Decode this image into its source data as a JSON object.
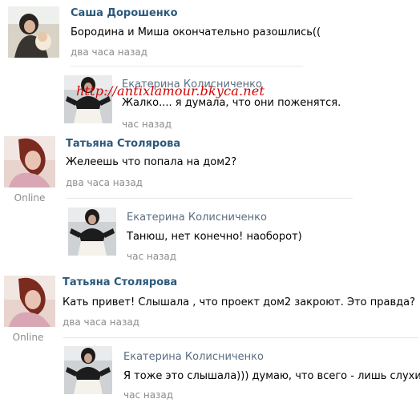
{
  "watermark": "http://antixlamour.bkyca.net",
  "comments": [
    {
      "author": "Саша Дорошенко",
      "text": "Бородина и Миша окончательно разошлись((",
      "time": "два часа назад"
    },
    {
      "author": "Екатерина Колисниченко",
      "text": "Жалко.... я думала, что они поженятся.",
      "time": "час назад"
    },
    {
      "author": "Татьяна Столярова",
      "text": "Желеешь что попала на дом2?",
      "time": "два часа назад",
      "status": "Online"
    },
    {
      "author": "Екатерина Колисниченко",
      "text": "Танюш, нет конечно! наоборот)",
      "time": "час назад"
    },
    {
      "author": "Татьяна Столярова",
      "text": "Кать привет! Слышала , что проект дом2 закроют. Это правда?",
      "time": "два часа назад",
      "status": "Online"
    },
    {
      "author": "Екатерина Колисниченко",
      "text": "Я тоже это слышала))) думаю, что всего - лишь слухи)",
      "time": "час назад"
    }
  ]
}
